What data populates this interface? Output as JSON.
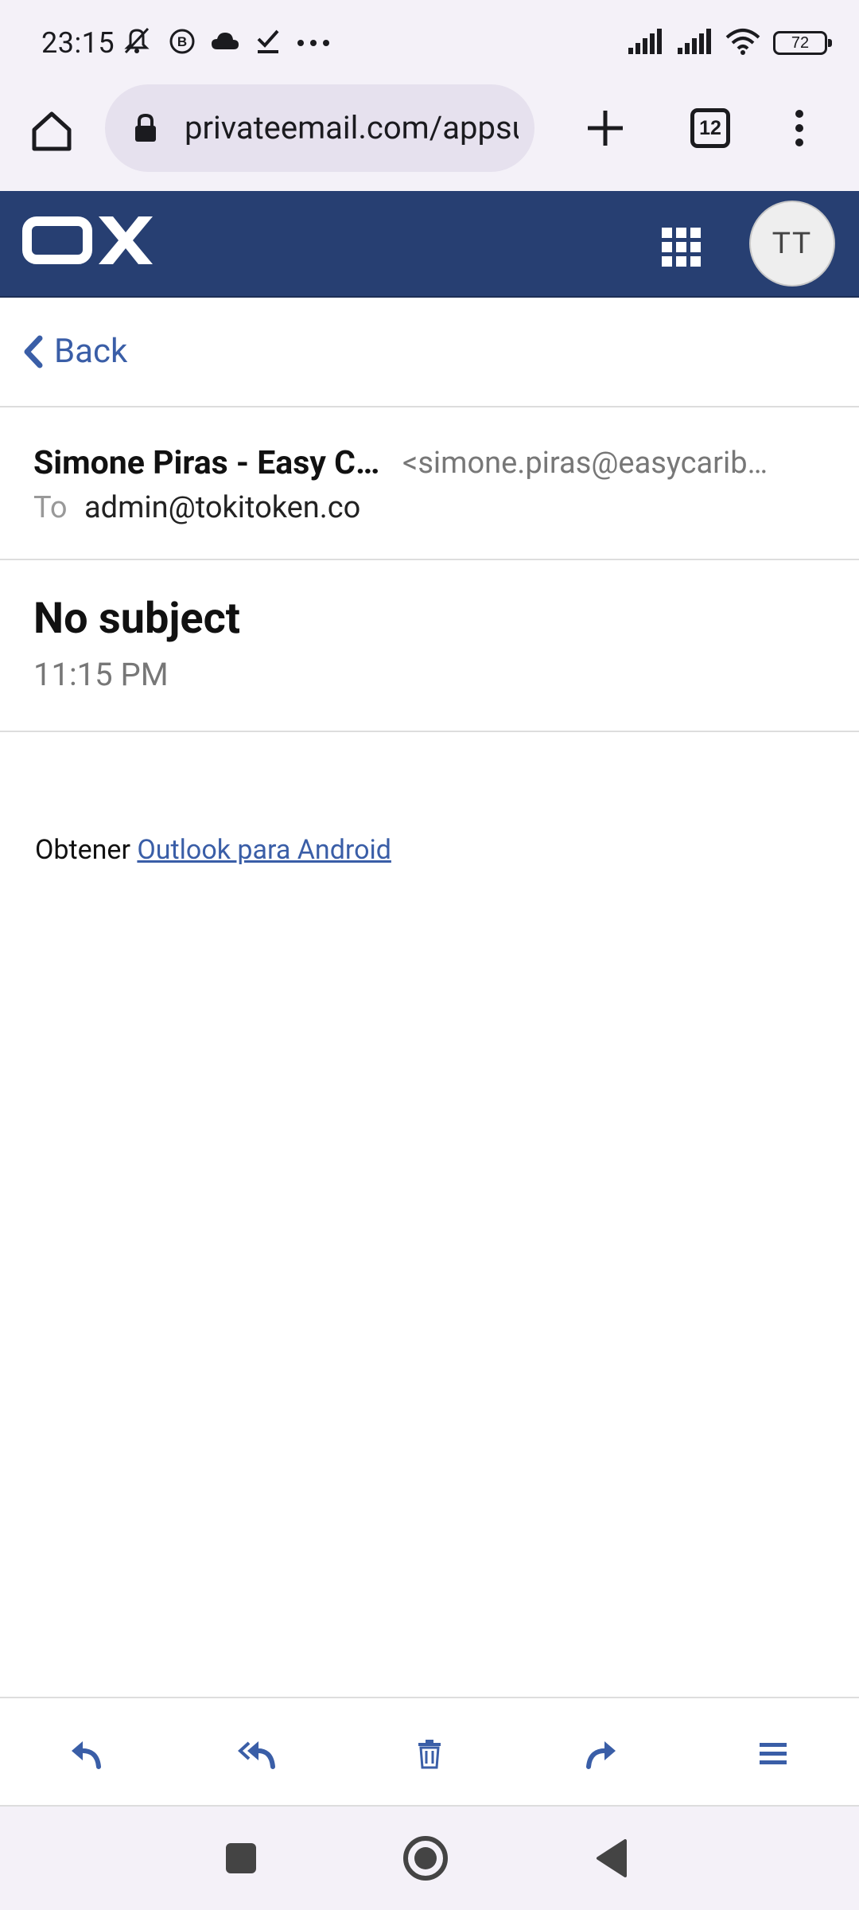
{
  "status_bar": {
    "time": "23:15",
    "battery": "72",
    "icons": [
      "mute-icon",
      "b-badge-icon",
      "cloud-icon",
      "check-icon",
      "more-dots-icon",
      "signal-icon",
      "signal-icon",
      "wifi-icon",
      "battery-icon"
    ]
  },
  "browser": {
    "url": "privateemail.com/appsuite",
    "tab_count": "12"
  },
  "app": {
    "logo_text": "OX",
    "avatar_initials": "TT"
  },
  "nav": {
    "back_label": "Back"
  },
  "message": {
    "sender_name": "Simone Piras - Easy Carib",
    "sender_email": "<simone.piras@easycaribbean.com>",
    "to_label": "To",
    "to_value": "admin@tokitoken.co",
    "subject": "No subject",
    "date": "11:15 PM",
    "body_prefix": "Obtener",
    "body_link": "Outlook para Android"
  },
  "actions": [
    "reply",
    "reply-all",
    "delete",
    "forward",
    "more"
  ],
  "colors": {
    "header_bg": "#273f72",
    "accent": "#3a5ea7",
    "system_bar_bg": "#f4f1f8"
  }
}
